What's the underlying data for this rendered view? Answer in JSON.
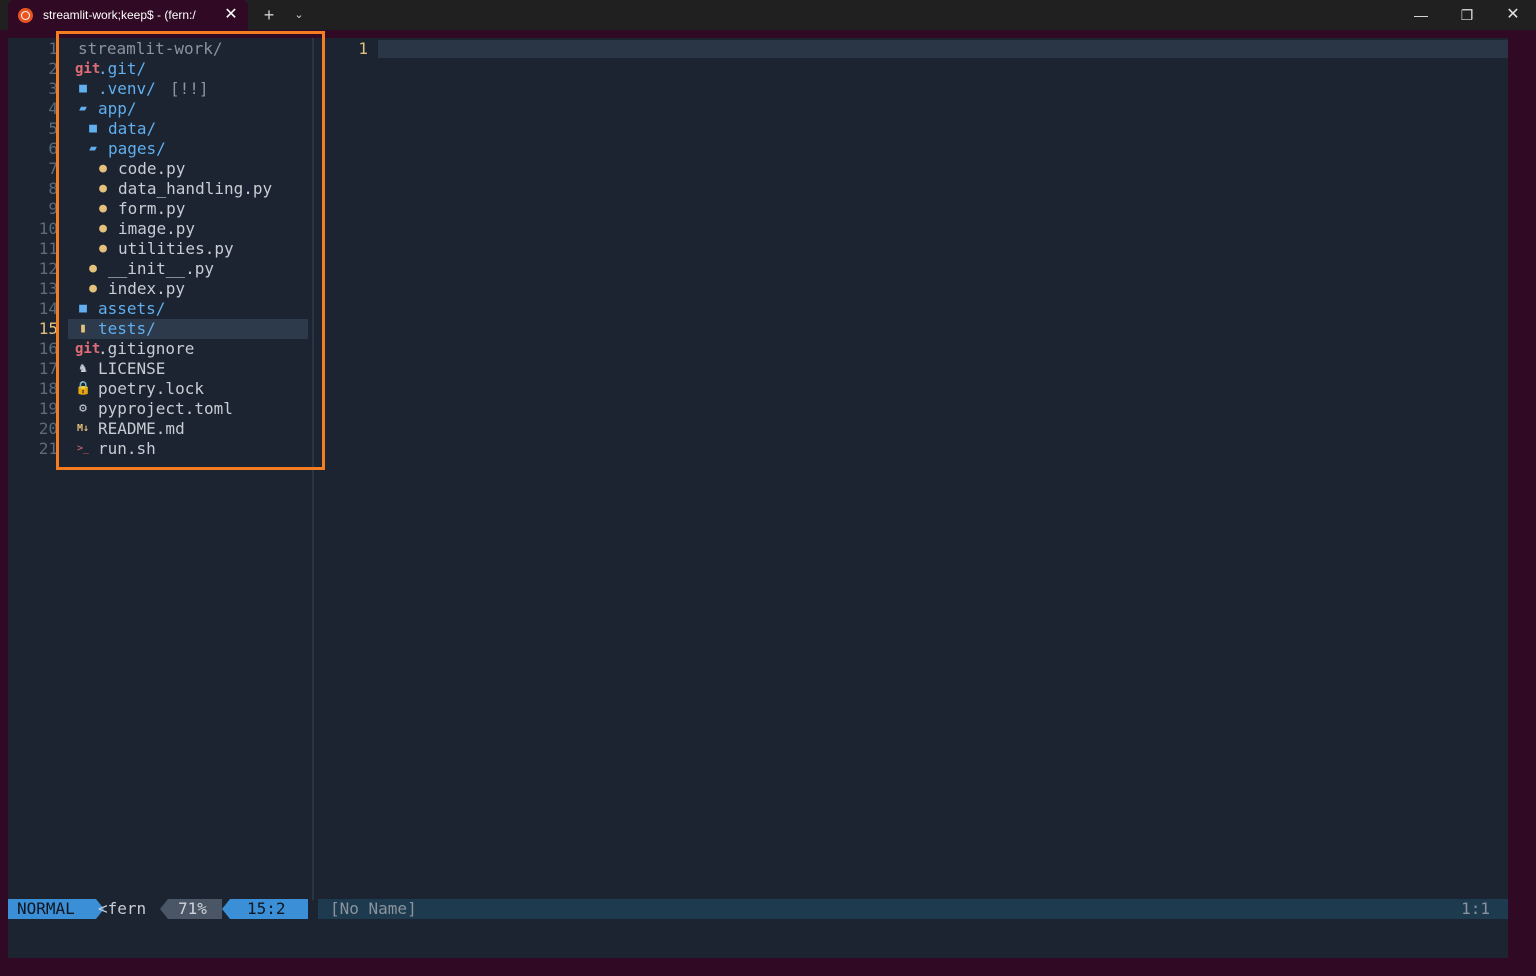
{
  "window": {
    "tab_title": "streamlit-work;keep$ - (fern:/",
    "new_tab": "+",
    "dropdown": "⌄",
    "minimize": "—",
    "maximize": "❐",
    "close": "✕",
    "tab_close": "✕"
  },
  "gutter": {
    "lines": [
      "1",
      "2",
      "3",
      "4",
      "5",
      "6",
      "7",
      "8",
      "9",
      "10",
      "11",
      "12",
      "13",
      "14",
      "15",
      "16",
      "17",
      "18",
      "19",
      "20",
      "21"
    ],
    "current_line": "15"
  },
  "tree": {
    "root": "streamlit-work/",
    "items": [
      {
        "label": ".git/",
        "icon": "git-icon",
        "icon_text": "git",
        "kind": "dir"
      },
      {
        "label": ".venv/",
        "suffix": "[!!]",
        "icon": "folder-icon",
        "kind": "dir"
      },
      {
        "label": "app/",
        "icon": "folder-open-icon",
        "kind": "dir"
      },
      {
        "label": "data/",
        "icon": "folder-icon",
        "kind": "dir"
      },
      {
        "label": "pages/",
        "icon": "folder-open-icon",
        "kind": "dir"
      },
      {
        "label": "code.py",
        "icon": "python-icon",
        "kind": "file"
      },
      {
        "label": "data_handling.py",
        "icon": "python-icon",
        "kind": "file"
      },
      {
        "label": "form.py",
        "icon": "python-icon",
        "kind": "file"
      },
      {
        "label": "image.py",
        "icon": "python-icon",
        "kind": "file"
      },
      {
        "label": "utilities.py",
        "icon": "python-icon",
        "kind": "file"
      },
      {
        "label": "__init__.py",
        "icon": "python-icon",
        "kind": "file"
      },
      {
        "label": "index.py",
        "icon": "python-icon",
        "kind": "file"
      },
      {
        "label": "assets/",
        "icon": "folder-icon",
        "kind": "dir"
      },
      {
        "label": "tests/",
        "icon": "test-folder-icon",
        "kind": "dir"
      },
      {
        "label": ".gitignore",
        "icon": "git-icon",
        "icon_text": "git",
        "kind": "file"
      },
      {
        "label": "LICENSE",
        "icon": "license-icon",
        "kind": "file"
      },
      {
        "label": "poetry.lock",
        "icon": "lock-icon",
        "kind": "file"
      },
      {
        "label": "pyproject.toml",
        "icon": "gear-icon",
        "kind": "file"
      },
      {
        "label": "README.md",
        "icon": "markdown-icon",
        "icon_text": "M↓",
        "kind": "file"
      },
      {
        "label": "run.sh",
        "icon": "terminal-icon",
        "icon_text": ">_",
        "kind": "file"
      }
    ]
  },
  "editor": {
    "line_number": "1"
  },
  "statusline": {
    "mode": "NORMAL",
    "buffer": "<fern",
    "percent": "71%",
    "position": "15:2",
    "right_buffer": "[No Name]",
    "right_position": "1:1"
  },
  "colors": {
    "accent": "#f57c20",
    "mode_bg": "#3b8fd6",
    "terminal_bg": "#1b2430",
    "frame_bg": "#300a24"
  }
}
